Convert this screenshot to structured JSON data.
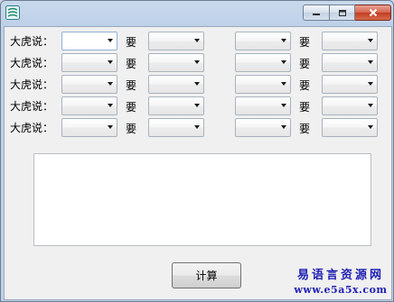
{
  "window": {
    "icon": "app-logo-icon",
    "controls": {
      "minimize_icon": "minimize-icon",
      "maximize_icon": "maximize-icon",
      "close_icon": "close-icon"
    }
  },
  "rows": [
    {
      "label": "大虎说：",
      "connector_left": "要",
      "connector_right": "要",
      "combos": [
        "",
        "",
        "",
        ""
      ]
    },
    {
      "label": "大虎说：",
      "connector_left": "要",
      "connector_right": "要",
      "combos": [
        "",
        "",
        "",
        ""
      ]
    },
    {
      "label": "大虎说：",
      "connector_left": "要",
      "connector_right": "要",
      "combos": [
        "",
        "",
        "",
        ""
      ]
    },
    {
      "label": "大虎说：",
      "connector_left": "要",
      "connector_right": "要",
      "combos": [
        "",
        "",
        "",
        ""
      ]
    },
    {
      "label": "大虎说：",
      "connector_left": "要",
      "connector_right": "要",
      "combos": [
        "",
        "",
        "",
        ""
      ]
    }
  ],
  "output": {
    "value": ""
  },
  "buttons": {
    "calculate": "计算"
  },
  "watermark": {
    "line1": "易语言资源网",
    "line2": "www.e5a5x.com"
  },
  "colors": {
    "watermark": "#1f1fb4",
    "close_button": "#c43c22"
  }
}
